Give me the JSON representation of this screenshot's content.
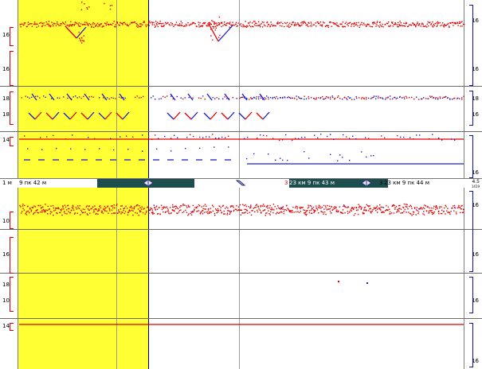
{
  "status_bar": {
    "scale_left": "1 м",
    "position_left": "9 пк 42 м",
    "position_center_prefix": "3",
    "position_center": "23 км 9 пк 43 м",
    "position_right_prefix": "3",
    "position_right": "23 км 9 пк 44 м",
    "scale_right_top": "4.5",
    "scale_right_bottom": "1419"
  },
  "top_panel": {
    "channels": [
      {
        "left_label": "16",
        "right_label": "16"
      },
      {
        "left_label": "16",
        "right_label": "16"
      },
      {
        "left_label": "18",
        "right_label": ""
      },
      {
        "left_label": "18",
        "right_label": "16"
      },
      {
        "left_label": "14",
        "right_label": "16"
      }
    ],
    "right_extra_label": "18"
  },
  "bottom_panel": {
    "channels": [
      {
        "left_label": "10",
        "right_label": "16"
      },
      {
        "left_label": "16",
        "right_label": "16"
      },
      {
        "left_label": "18",
        "right_label": "16"
      },
      {
        "left_label": "10",
        "right_label": ""
      },
      {
        "left_label": "14",
        "right_label": "16"
      }
    ]
  },
  "colors": {
    "highlight": "#ffff33",
    "red_signal": "#e00000",
    "blue_signal": "#1c1cd0",
    "status_dark": "#1d4d4d"
  }
}
